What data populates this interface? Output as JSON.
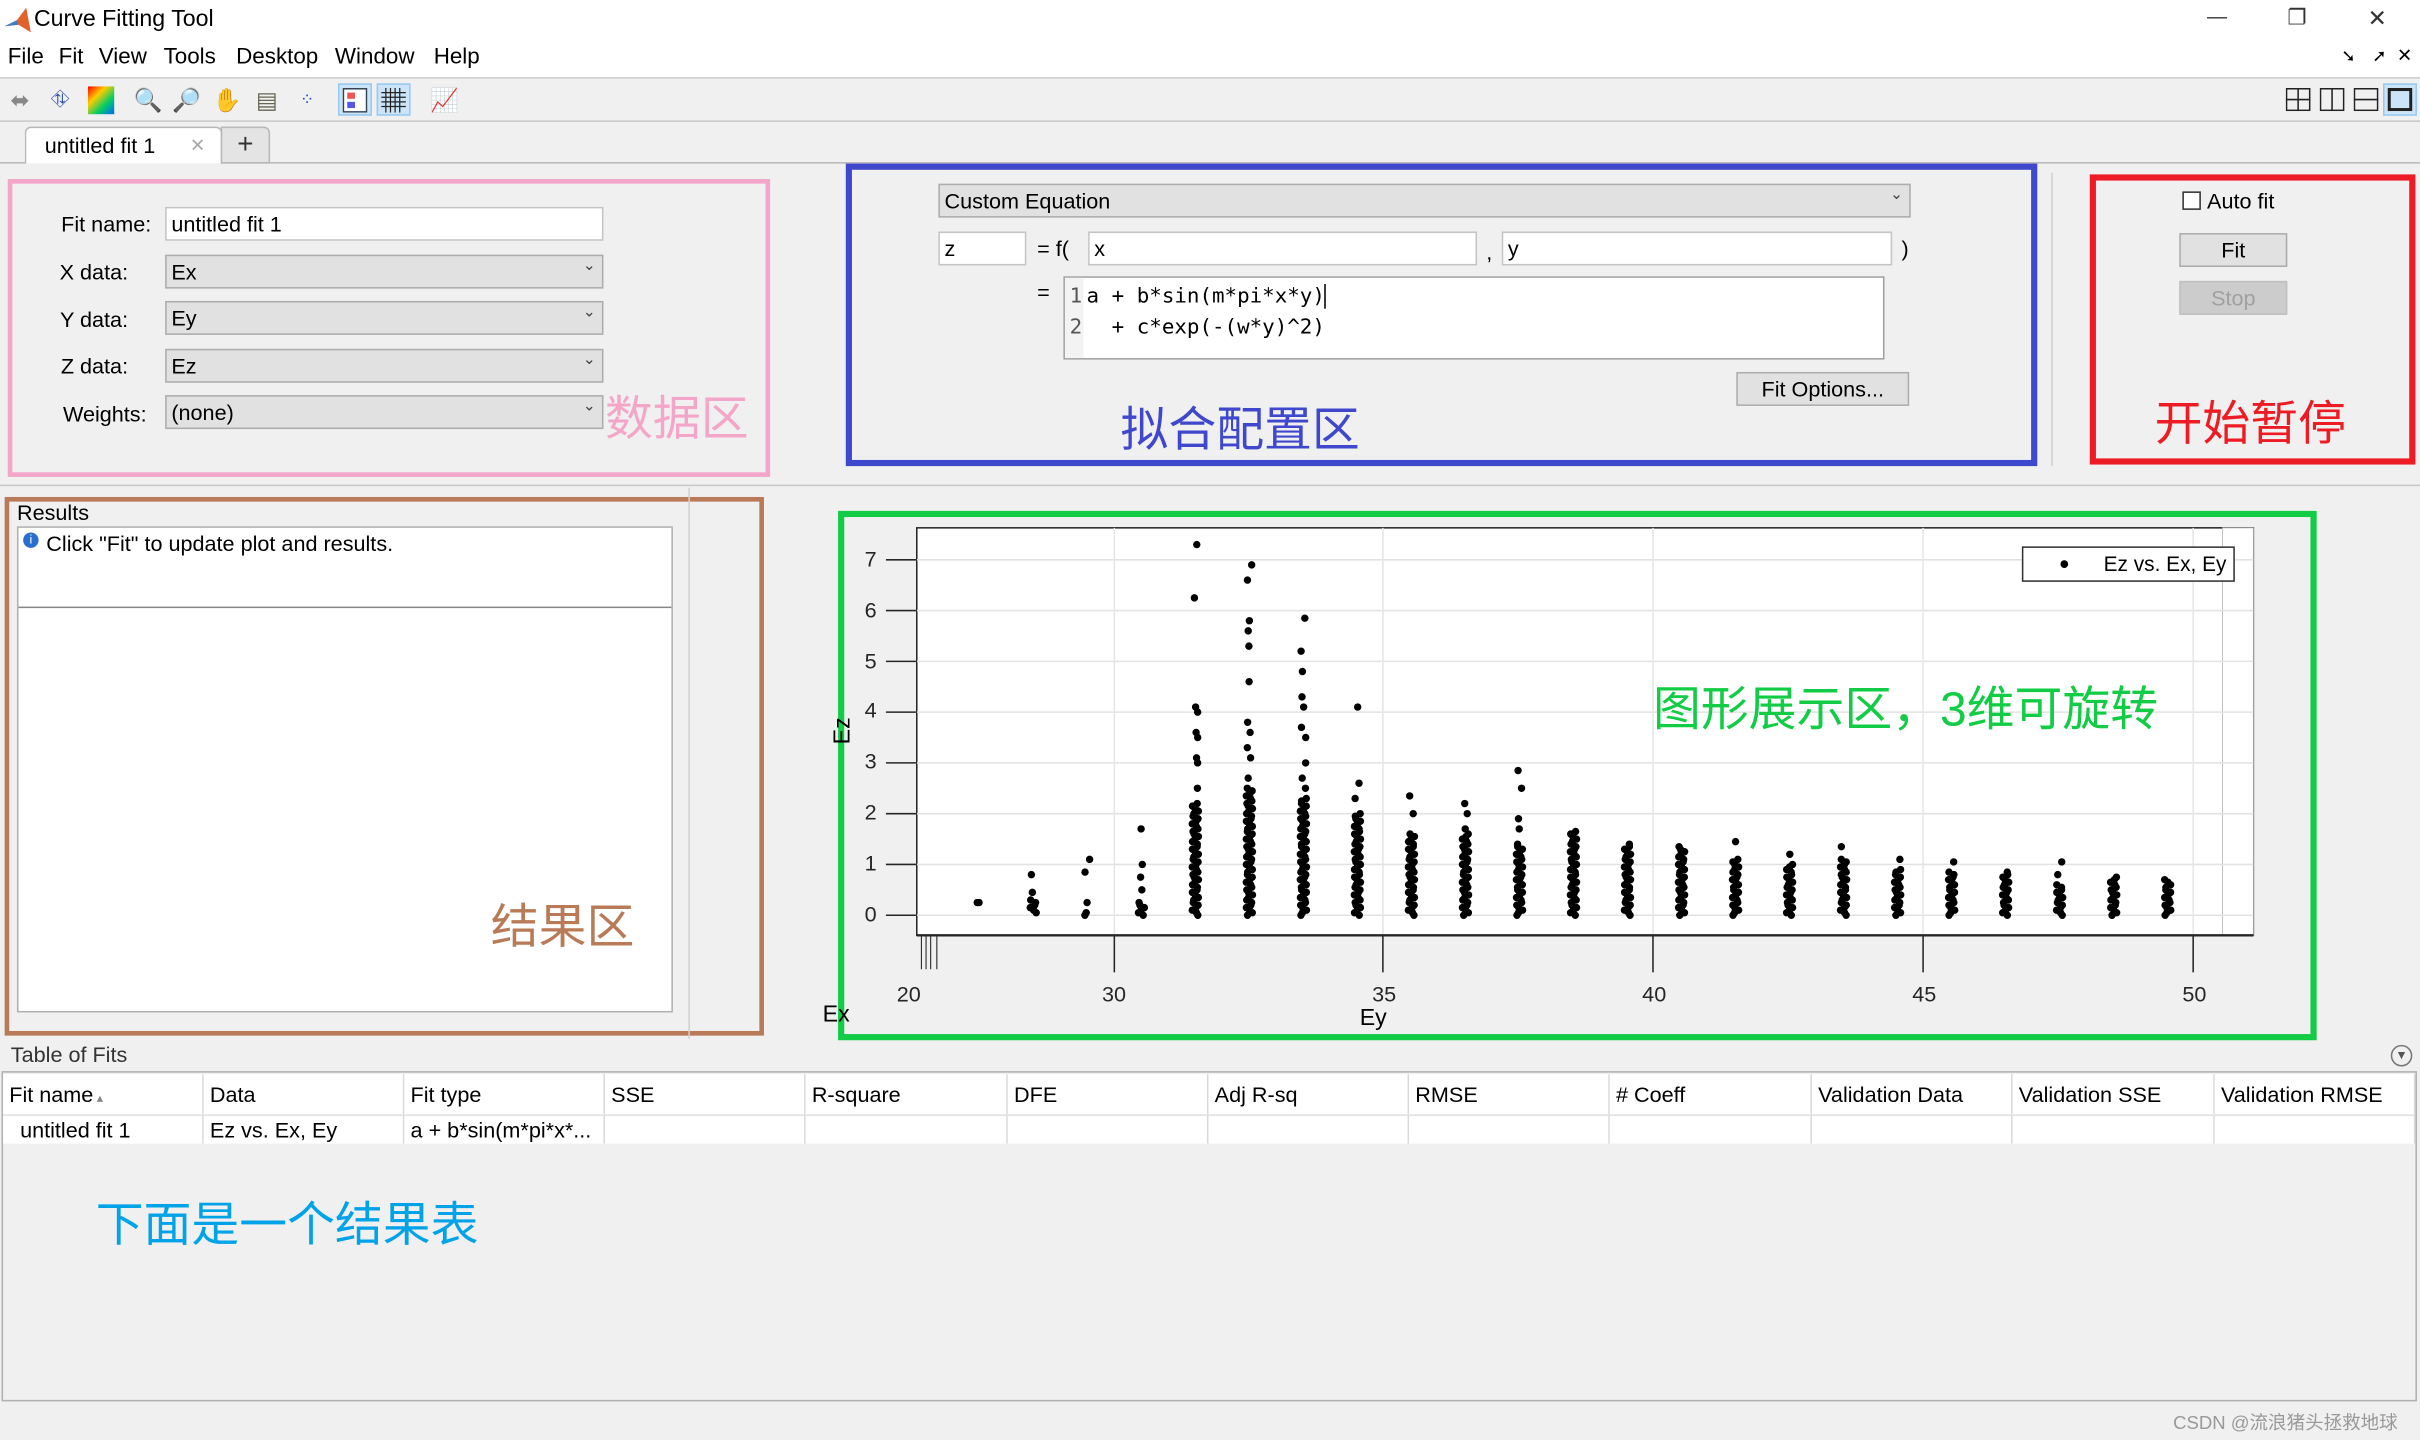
{
  "window": {
    "title": "Curve Fitting Tool",
    "minimize": "—",
    "restore": "❐",
    "close": "✕"
  },
  "menu": [
    "File",
    "Fit",
    "View",
    "Tools",
    "Desktop",
    "Window",
    "Help"
  ],
  "toolbar_icons": [
    "rotate-icon",
    "data-cursor-icon",
    "colormap-icon",
    "zoom-in-icon",
    "zoom-out-icon",
    "pan-icon",
    "data-tip-icon",
    "exclude-outliers-icon",
    "legend-icon",
    "grid-icon",
    "axes-limits-icon"
  ],
  "layout_icons": [
    "grid-2x2-icon",
    "split-vertical-icon",
    "split-horizontal-icon",
    "single-view-icon"
  ],
  "tabs": [
    {
      "label": "untitled fit 1",
      "close": "✕"
    }
  ],
  "add_tab": "+",
  "data_panel": {
    "fit_name_label": "Fit name:",
    "fit_name": "untitled fit 1",
    "x_label": "X data:",
    "x_value": "Ex",
    "y_label": "Y data:",
    "y_value": "Ey",
    "z_label": "Z data:",
    "z_value": "Ez",
    "weights_label": "Weights:",
    "weights_value": "(none)",
    "annotation": "数据区"
  },
  "fit_config": {
    "fit_type": "Custom Equation",
    "output_var": "z",
    "eq_f": "= f(",
    "x_var": "x",
    "comma": ",",
    "y_var": "y",
    "close_paren": ")",
    "eq_sign": "=",
    "equation_lines": [
      {
        "num": "1",
        "text": "a + b*sin(m*pi*x*y)"
      },
      {
        "num": "2",
        "text": "  + c*exp(-(w*y)^2)"
      }
    ],
    "fit_options": "Fit Options...",
    "annotation": "拟合配置区"
  },
  "controls": {
    "auto_fit_label": "Auto fit",
    "auto_fit_checked": false,
    "fit": "Fit",
    "stop": "Stop",
    "annotation": "开始暂停"
  },
  "results": {
    "title": "Results",
    "message": "Click \"Fit\" to update plot and results.",
    "annotation": "结果区"
  },
  "plot": {
    "annotation": "图形展示区，3维可旋转",
    "legend": "Ez vs. Ex, Ey",
    "z_label": "Ez",
    "x_label": "Ex",
    "y_label": "Ey"
  },
  "chart_data": {
    "type": "scatter",
    "view": "3d",
    "series": [
      {
        "name": "Ez vs. Ex, Ey"
      }
    ],
    "ylabel": "Ez",
    "xlabel": "Ey",
    "ex_label": "Ex",
    "x_ticks": [
      "30",
      "35",
      "40",
      "45",
      "50"
    ],
    "ex_tick": "20",
    "y_ticks": [
      "0",
      "1",
      "2",
      "3",
      "4",
      "5",
      "6",
      "7"
    ],
    "x_range": [
      27,
      50.5
    ],
    "y_range": [
      -0.3,
      7.5
    ],
    "grid": true,
    "legend_position": "top-right",
    "marker_color": "#000000",
    "columns": [
      {
        "ey": 27.5,
        "dense": [
          0.25,
          0.25
        ],
        "points": [
          0.25
        ]
      },
      {
        "ey": 28.5,
        "dense": [
          0.05,
          0.3
        ],
        "points": [
          0.45,
          0.8
        ]
      },
      {
        "ey": 29.5,
        "dense": [
          0.0,
          0.05
        ],
        "points": [
          0.25,
          0.85,
          1.1
        ]
      },
      {
        "ey": 30.5,
        "dense": [
          0.0,
          0.25
        ],
        "points": [
          0.5,
          0.75,
          1.0,
          1.7
        ]
      },
      {
        "ey": 31.5,
        "dense": [
          0.0,
          2.2
        ],
        "points": [
          2.5,
          3.0,
          3.1,
          3.5,
          3.6,
          4.0,
          4.1,
          6.25,
          7.3
        ]
      },
      {
        "ey": 32.5,
        "dense": [
          0.0,
          2.5
        ],
        "points": [
          2.7,
          3.1,
          3.3,
          3.6,
          3.8,
          4.6,
          5.3,
          5.6,
          5.8,
          6.6,
          6.9
        ]
      },
      {
        "ey": 33.5,
        "dense": [
          0.0,
          2.3
        ],
        "points": [
          2.5,
          2.7,
          3.0,
          3.5,
          3.7,
          4.1,
          4.3,
          4.8,
          5.2,
          5.85
        ]
      },
      {
        "ey": 34.5,
        "dense": [
          0.0,
          2.0
        ],
        "points": [
          2.3,
          2.6,
          4.1
        ]
      },
      {
        "ey": 35.5,
        "dense": [
          0.0,
          1.6
        ],
        "points": [
          2.0,
          2.35
        ]
      },
      {
        "ey": 36.5,
        "dense": [
          0.0,
          1.6
        ],
        "points": [
          1.7,
          2.0,
          2.2
        ]
      },
      {
        "ey": 37.5,
        "dense": [
          0.0,
          1.4
        ],
        "points": [
          1.7,
          1.9,
          2.5,
          2.85
        ]
      },
      {
        "ey": 38.5,
        "dense": [
          0.0,
          1.65
        ],
        "points": []
      },
      {
        "ey": 39.5,
        "dense": [
          0.0,
          1.4
        ],
        "points": []
      },
      {
        "ey": 40.5,
        "dense": [
          0.0,
          1.35
        ],
        "points": []
      },
      {
        "ey": 41.5,
        "dense": [
          0.0,
          1.1
        ],
        "points": [
          1.45
        ]
      },
      {
        "ey": 42.5,
        "dense": [
          0.0,
          1.0
        ],
        "points": [
          1.2
        ]
      },
      {
        "ey": 43.5,
        "dense": [
          0.0,
          1.1
        ],
        "points": [
          1.35
        ]
      },
      {
        "ey": 44.5,
        "dense": [
          0.0,
          0.9
        ],
        "points": [
          1.1
        ]
      },
      {
        "ey": 45.5,
        "dense": [
          0.0,
          0.85
        ],
        "points": [
          1.05
        ]
      },
      {
        "ey": 46.5,
        "dense": [
          0.0,
          0.85
        ],
        "points": []
      },
      {
        "ey": 47.5,
        "dense": [
          0.0,
          0.6
        ],
        "points": [
          0.8,
          1.05
        ]
      },
      {
        "ey": 48.5,
        "dense": [
          0.0,
          0.75
        ],
        "points": []
      },
      {
        "ey": 49.5,
        "dense": [
          0.0,
          0.7
        ],
        "points": []
      }
    ]
  },
  "table": {
    "title": "Table of Fits",
    "columns": [
      "Fit name",
      "Data",
      "Fit type",
      "SSE",
      "R-square",
      "DFE",
      "Adj R-sq",
      "RMSE",
      "# Coeff",
      "Validation Data",
      "Validation SSE",
      "Validation RMSE"
    ],
    "rows": [
      [
        "untitled fit 1",
        "Ez vs. Ex, Ey",
        "a + b*sin(m*pi*x*...",
        "",
        "",
        "",
        "",
        "",
        "",
        "",
        "",
        ""
      ]
    ],
    "annotation": "下面是一个结果表"
  },
  "watermark": "CSDN @流浪猪头拯救地球",
  "colors": {
    "data_box": "#f4a6c8",
    "config_box": "#3f48cc",
    "control_box": "#ed1c24",
    "results_box": "#b97a57",
    "plot_box": "#11cc44",
    "table_note": "#00a2e8"
  }
}
